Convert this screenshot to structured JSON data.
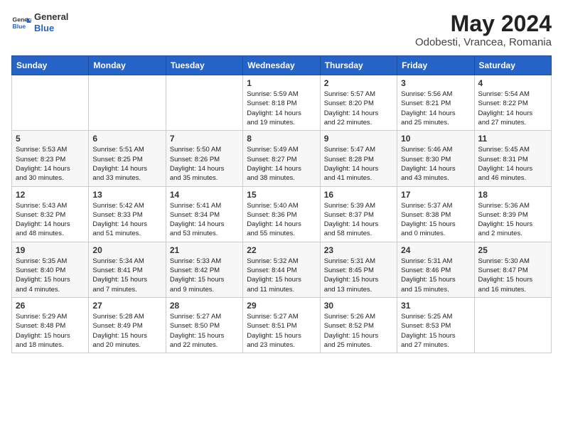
{
  "header": {
    "logo_line1": "General",
    "logo_line2": "Blue",
    "month_year": "May 2024",
    "location": "Odobesti, Vrancea, Romania"
  },
  "weekdays": [
    "Sunday",
    "Monday",
    "Tuesday",
    "Wednesday",
    "Thursday",
    "Friday",
    "Saturday"
  ],
  "weeks": [
    [
      {
        "day": "",
        "info": ""
      },
      {
        "day": "",
        "info": ""
      },
      {
        "day": "",
        "info": ""
      },
      {
        "day": "1",
        "info": "Sunrise: 5:59 AM\nSunset: 8:18 PM\nDaylight: 14 hours\nand 19 minutes."
      },
      {
        "day": "2",
        "info": "Sunrise: 5:57 AM\nSunset: 8:20 PM\nDaylight: 14 hours\nand 22 minutes."
      },
      {
        "day": "3",
        "info": "Sunrise: 5:56 AM\nSunset: 8:21 PM\nDaylight: 14 hours\nand 25 minutes."
      },
      {
        "day": "4",
        "info": "Sunrise: 5:54 AM\nSunset: 8:22 PM\nDaylight: 14 hours\nand 27 minutes."
      }
    ],
    [
      {
        "day": "5",
        "info": "Sunrise: 5:53 AM\nSunset: 8:23 PM\nDaylight: 14 hours\nand 30 minutes."
      },
      {
        "day": "6",
        "info": "Sunrise: 5:51 AM\nSunset: 8:25 PM\nDaylight: 14 hours\nand 33 minutes."
      },
      {
        "day": "7",
        "info": "Sunrise: 5:50 AM\nSunset: 8:26 PM\nDaylight: 14 hours\nand 35 minutes."
      },
      {
        "day": "8",
        "info": "Sunrise: 5:49 AM\nSunset: 8:27 PM\nDaylight: 14 hours\nand 38 minutes."
      },
      {
        "day": "9",
        "info": "Sunrise: 5:47 AM\nSunset: 8:28 PM\nDaylight: 14 hours\nand 41 minutes."
      },
      {
        "day": "10",
        "info": "Sunrise: 5:46 AM\nSunset: 8:30 PM\nDaylight: 14 hours\nand 43 minutes."
      },
      {
        "day": "11",
        "info": "Sunrise: 5:45 AM\nSunset: 8:31 PM\nDaylight: 14 hours\nand 46 minutes."
      }
    ],
    [
      {
        "day": "12",
        "info": "Sunrise: 5:43 AM\nSunset: 8:32 PM\nDaylight: 14 hours\nand 48 minutes."
      },
      {
        "day": "13",
        "info": "Sunrise: 5:42 AM\nSunset: 8:33 PM\nDaylight: 14 hours\nand 51 minutes."
      },
      {
        "day": "14",
        "info": "Sunrise: 5:41 AM\nSunset: 8:34 PM\nDaylight: 14 hours\nand 53 minutes."
      },
      {
        "day": "15",
        "info": "Sunrise: 5:40 AM\nSunset: 8:36 PM\nDaylight: 14 hours\nand 55 minutes."
      },
      {
        "day": "16",
        "info": "Sunrise: 5:39 AM\nSunset: 8:37 PM\nDaylight: 14 hours\nand 58 minutes."
      },
      {
        "day": "17",
        "info": "Sunrise: 5:37 AM\nSunset: 8:38 PM\nDaylight: 15 hours\nand 0 minutes."
      },
      {
        "day": "18",
        "info": "Sunrise: 5:36 AM\nSunset: 8:39 PM\nDaylight: 15 hours\nand 2 minutes."
      }
    ],
    [
      {
        "day": "19",
        "info": "Sunrise: 5:35 AM\nSunset: 8:40 PM\nDaylight: 15 hours\nand 4 minutes."
      },
      {
        "day": "20",
        "info": "Sunrise: 5:34 AM\nSunset: 8:41 PM\nDaylight: 15 hours\nand 7 minutes."
      },
      {
        "day": "21",
        "info": "Sunrise: 5:33 AM\nSunset: 8:42 PM\nDaylight: 15 hours\nand 9 minutes."
      },
      {
        "day": "22",
        "info": "Sunrise: 5:32 AM\nSunset: 8:44 PM\nDaylight: 15 hours\nand 11 minutes."
      },
      {
        "day": "23",
        "info": "Sunrise: 5:31 AM\nSunset: 8:45 PM\nDaylight: 15 hours\nand 13 minutes."
      },
      {
        "day": "24",
        "info": "Sunrise: 5:31 AM\nSunset: 8:46 PM\nDaylight: 15 hours\nand 15 minutes."
      },
      {
        "day": "25",
        "info": "Sunrise: 5:30 AM\nSunset: 8:47 PM\nDaylight: 15 hours\nand 16 minutes."
      }
    ],
    [
      {
        "day": "26",
        "info": "Sunrise: 5:29 AM\nSunset: 8:48 PM\nDaylight: 15 hours\nand 18 minutes."
      },
      {
        "day": "27",
        "info": "Sunrise: 5:28 AM\nSunset: 8:49 PM\nDaylight: 15 hours\nand 20 minutes."
      },
      {
        "day": "28",
        "info": "Sunrise: 5:27 AM\nSunset: 8:50 PM\nDaylight: 15 hours\nand 22 minutes."
      },
      {
        "day": "29",
        "info": "Sunrise: 5:27 AM\nSunset: 8:51 PM\nDaylight: 15 hours\nand 23 minutes."
      },
      {
        "day": "30",
        "info": "Sunrise: 5:26 AM\nSunset: 8:52 PM\nDaylight: 15 hours\nand 25 minutes."
      },
      {
        "day": "31",
        "info": "Sunrise: 5:25 AM\nSunset: 8:53 PM\nDaylight: 15 hours\nand 27 minutes."
      },
      {
        "day": "",
        "info": ""
      }
    ]
  ]
}
